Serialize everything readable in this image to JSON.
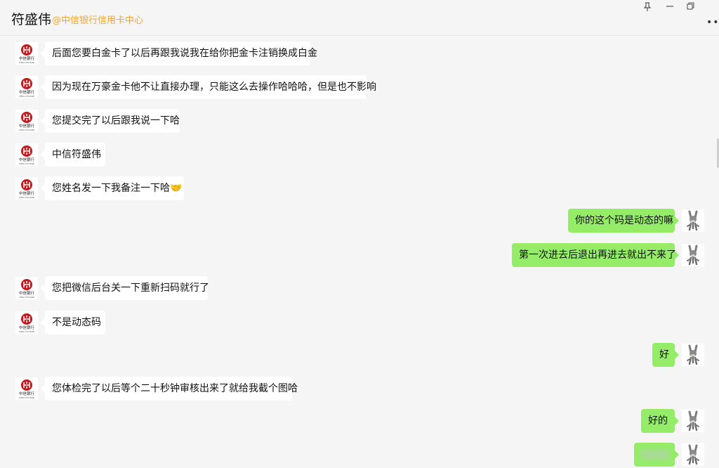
{
  "header": {
    "title": "符盛伟",
    "subtitle": "@中信银行信用卡中心",
    "pin_icon": "pin-icon",
    "minimize_icon": "minimize-icon",
    "restore_icon": "restore-icon",
    "more_icon": "more-icon"
  },
  "colors": {
    "background": "#f5f5f5",
    "incoming_bubble": "#ffffff",
    "outgoing_bubble": "#95ec69",
    "subtitle": "#f2a53a",
    "bank_red": "#c8161d"
  },
  "contacts": {
    "bank_avatar_caption": "中信银行",
    "bank_avatar_en": "CHINA CITIC BANK"
  },
  "messages": [
    {
      "side": "left",
      "text": "后面您要白金卡了以后再跟我说我在给你把金卡注销换成白金"
    },
    {
      "side": "left",
      "text": "因为现在万豪金卡他不让直接办理，只能这么去操作哈哈哈，但是也不影响"
    },
    {
      "side": "left",
      "text": "您提交完了以后跟我说一下哈"
    },
    {
      "side": "left",
      "text": "中信符盛伟"
    },
    {
      "side": "left",
      "text": "您姓名发一下我备注一下哈🤝"
    },
    {
      "side": "right",
      "text": "你的这个码是动态的嘛"
    },
    {
      "side": "right",
      "text": "第一次进去后退出再进去就出不来了"
    },
    {
      "side": "left",
      "text": "您把微信后台关一下重新扫码就行了"
    },
    {
      "side": "left",
      "text": "不是动态码"
    },
    {
      "side": "right",
      "text": "好"
    },
    {
      "side": "left",
      "text": "您体检完了以后等个二十秒钟审核出来了就给我截个图哈"
    },
    {
      "side": "right",
      "text": "好的"
    },
    {
      "side": "right",
      "text": ""
    }
  ]
}
